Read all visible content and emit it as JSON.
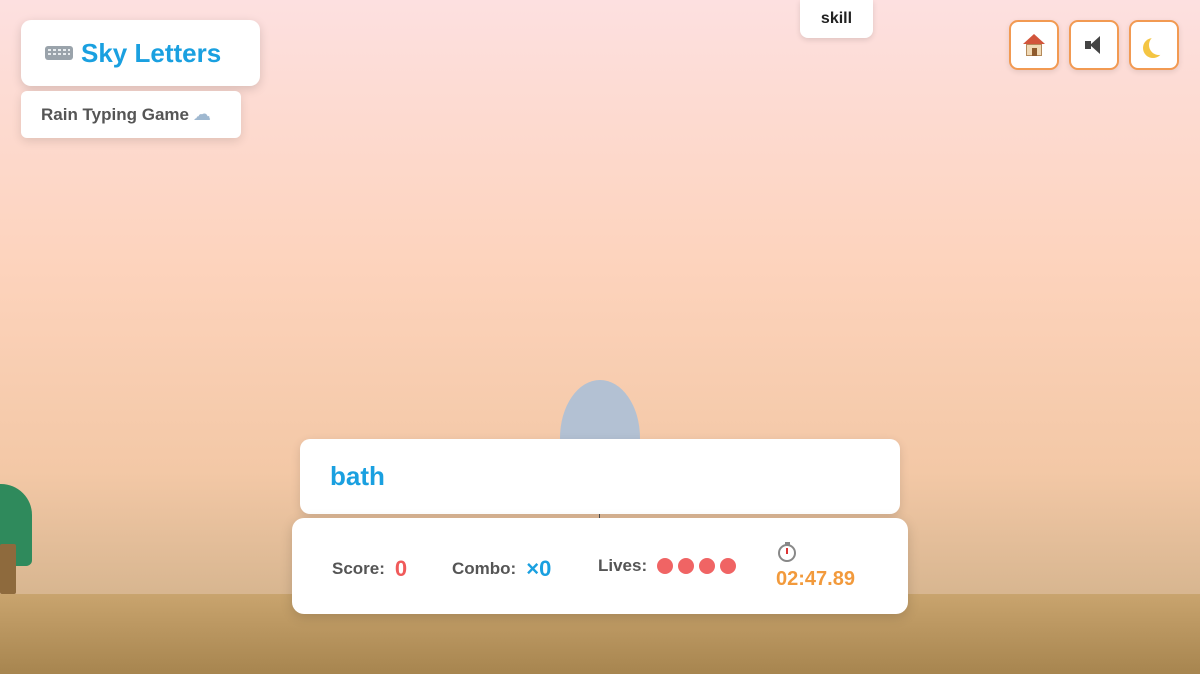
{
  "header": {
    "title": "Sky Letters",
    "title_icon": "keyboard-icon",
    "subtitle": "Rain Typing Game",
    "subtitle_icon": "rain-cloud-icon"
  },
  "top_chip": {
    "label": "skill"
  },
  "controls": {
    "home_icon": "house-icon",
    "sound_icon": "speaker-muted-icon",
    "theme_icon": "moon-icon",
    "accent_color": "#f29a52"
  },
  "game": {
    "falling_word": "bath",
    "current_input": ""
  },
  "stats": {
    "score_label": "Score:",
    "score_value": "0",
    "combo_label": "Combo:",
    "combo_value": "×0",
    "lives_label": "Lives:",
    "lives_count": 4,
    "timer_icon": "stopwatch-icon",
    "timer_value": "02:47.89"
  },
  "colors": {
    "title": "#1aa0e0",
    "score": "#f05a5a",
    "combo": "#1aa0e0",
    "lives": "#f06464",
    "timer": "#f29a3c"
  }
}
